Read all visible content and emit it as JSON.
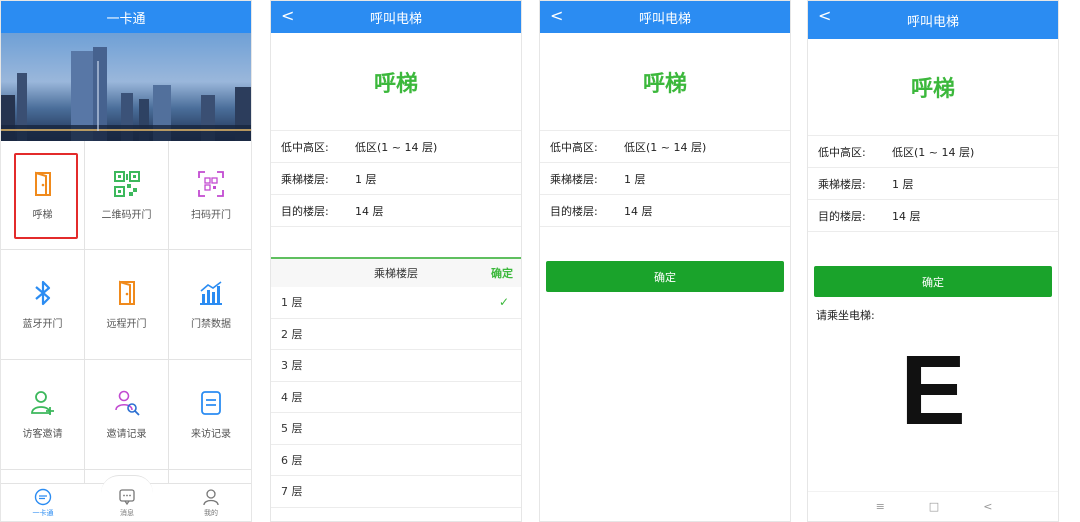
{
  "screen1": {
    "title": "一卡通",
    "grid": [
      {
        "label": "呼梯",
        "icon": "door-icon"
      },
      {
        "label": "二维码开门",
        "icon": "qr-code-icon"
      },
      {
        "label": "扫码开门",
        "icon": "scan-code-icon"
      },
      {
        "label": "蓝牙开门",
        "icon": "bluetooth-icon"
      },
      {
        "label": "远程开门",
        "icon": "door-icon"
      },
      {
        "label": "门禁数据",
        "icon": "data-chart-icon"
      },
      {
        "label": "访客邀请",
        "icon": "add-person-icon"
      },
      {
        "label": "邀请记录",
        "icon": "search-person-icon"
      },
      {
        "label": "来访记录",
        "icon": "document-icon"
      }
    ],
    "tabs": [
      {
        "label": "一卡通",
        "icon": "card-icon",
        "active": true
      },
      {
        "label": "消息",
        "icon": "message-icon",
        "active": false
      },
      {
        "label": "我的",
        "icon": "person-icon",
        "active": false
      }
    ]
  },
  "elevator": {
    "title": "呼叫电梯",
    "back": "<",
    "heading": "呼梯",
    "rows": [
      {
        "key": "低中高区:",
        "value": "低区(1 ~ 14 层)"
      },
      {
        "key": "乘梯楼层:",
        "value": "1 层"
      },
      {
        "key": "目的楼层:",
        "value": "14 层"
      }
    ],
    "confirm_label": "确定",
    "wait_label": "请乘坐电梯:",
    "elevator_letter": "E"
  },
  "picker": {
    "title": "乘梯楼层",
    "ok_label": "确定",
    "options": [
      "1 层",
      "2 层",
      "3 层",
      "4 层",
      "5 层",
      "6 层",
      "7 层"
    ],
    "selected": "1 层"
  },
  "system_nav": {
    "menu": "≡",
    "home": "□",
    "back": "<"
  },
  "colors": {
    "header": "#2b8cf2",
    "accent_green": "#3cb83c",
    "button_green": "#1aa32b",
    "highlight_red": "#e32b2b"
  }
}
